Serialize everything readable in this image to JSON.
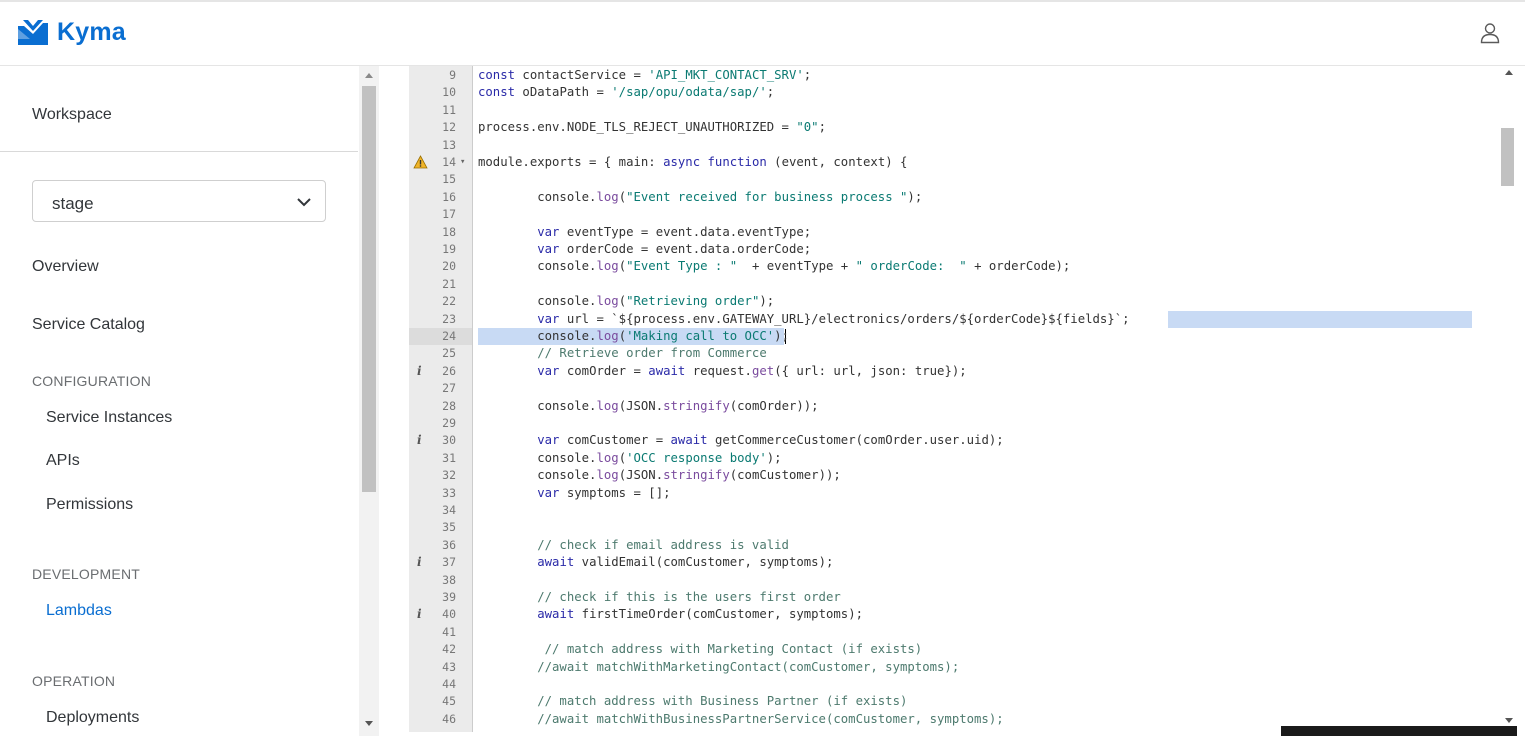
{
  "header": {
    "app_name": "Kyma",
    "logo_icon": "kyma-logo-icon",
    "user_icon": "user-icon",
    "accent": "#0a6ed1"
  },
  "sidebar": {
    "workspace": "Workspace",
    "namespace_select": {
      "value": "stage",
      "icon": "chevron-down-icon"
    },
    "overview": "Overview",
    "service_catalog": "Service Catalog",
    "sections": {
      "configuration": "CONFIGURATION",
      "development": "DEVELOPMENT",
      "operation": "OPERATION"
    },
    "configuration_items": [
      "Service Instances",
      "APIs",
      "Permissions"
    ],
    "development_items": [
      "Lambdas"
    ],
    "operation_items": [
      "Deployments"
    ],
    "active_item": "Lambdas"
  },
  "editor": {
    "lines": [
      {
        "n": "9",
        "marker": "",
        "fold": false,
        "text": "const contactService = 'API_MKT_CONTACT_SRV';"
      },
      {
        "n": "10",
        "marker": "",
        "fold": false,
        "text": "const oDataPath = '/sap/opu/odata/sap/';"
      },
      {
        "n": "11",
        "marker": "",
        "fold": false,
        "text": ""
      },
      {
        "n": "12",
        "marker": "",
        "fold": false,
        "text": "process.env.NODE_TLS_REJECT_UNAUTHORIZED = \"0\";"
      },
      {
        "n": "13",
        "marker": "",
        "fold": false,
        "text": ""
      },
      {
        "n": "14",
        "marker": "warning",
        "fold": true,
        "text": "module.exports = { main: async function (event, context) {"
      },
      {
        "n": "15",
        "marker": "",
        "fold": false,
        "text": ""
      },
      {
        "n": "16",
        "marker": "",
        "fold": false,
        "text": "        console.log(\"Event received for business process \");"
      },
      {
        "n": "17",
        "marker": "",
        "fold": false,
        "text": ""
      },
      {
        "n": "18",
        "marker": "",
        "fold": false,
        "text": "        var eventType = event.data.eventType;"
      },
      {
        "n": "19",
        "marker": "",
        "fold": false,
        "text": "        var orderCode = event.data.orderCode;"
      },
      {
        "n": "20",
        "marker": "",
        "fold": false,
        "text": "        console.log(\"Event Type : \"  + eventType + \" orderCode:  \" + orderCode);"
      },
      {
        "n": "21",
        "marker": "",
        "fold": false,
        "text": ""
      },
      {
        "n": "22",
        "marker": "",
        "fold": false,
        "text": "        console.log(\"Retrieving order\");"
      },
      {
        "n": "23",
        "marker": "",
        "fold": false,
        "text": "        var url = `${process.env.GATEWAY_URL}/electronics/orders/${orderCode}${fields}`;"
      },
      {
        "n": "24",
        "marker": "",
        "fold": false,
        "text": "        console.log('Making call to OCC');"
      },
      {
        "n": "25",
        "marker": "",
        "fold": false,
        "text": "        // Retrieve order from Commerce"
      },
      {
        "n": "26",
        "marker": "info",
        "fold": false,
        "text": "        var comOrder = await request.get({ url: url, json: true});"
      },
      {
        "n": "27",
        "marker": "",
        "fold": false,
        "text": ""
      },
      {
        "n": "28",
        "marker": "",
        "fold": false,
        "text": "        console.log(JSON.stringify(comOrder));"
      },
      {
        "n": "29",
        "marker": "",
        "fold": false,
        "text": ""
      },
      {
        "n": "30",
        "marker": "info",
        "fold": false,
        "text": "        var comCustomer = await getCommerceCustomer(comOrder.user.uid);"
      },
      {
        "n": "31",
        "marker": "",
        "fold": false,
        "text": "        console.log('OCC response body');"
      },
      {
        "n": "32",
        "marker": "",
        "fold": false,
        "text": "        console.log(JSON.stringify(comCustomer));"
      },
      {
        "n": "33",
        "marker": "",
        "fold": false,
        "text": "        var symptoms = [];"
      },
      {
        "n": "34",
        "marker": "",
        "fold": false,
        "text": ""
      },
      {
        "n": "35",
        "marker": "",
        "fold": false,
        "text": ""
      },
      {
        "n": "36",
        "marker": "",
        "fold": false,
        "text": "        // check if email address is valid"
      },
      {
        "n": "37",
        "marker": "info",
        "fold": false,
        "text": "        await validEmail(comCustomer, symptoms);"
      },
      {
        "n": "38",
        "marker": "",
        "fold": false,
        "text": ""
      },
      {
        "n": "39",
        "marker": "",
        "fold": false,
        "text": "        // check if this is the users first order"
      },
      {
        "n": "40",
        "marker": "info",
        "fold": false,
        "text": "        await firstTimeOrder(comCustomer, symptoms);"
      },
      {
        "n": "41",
        "marker": "",
        "fold": false,
        "text": ""
      },
      {
        "n": "42",
        "marker": "",
        "fold": false,
        "text": "         // match address with Marketing Contact (if exists)"
      },
      {
        "n": "43",
        "marker": "",
        "fold": false,
        "text": "        //await matchWithMarketingContact(comCustomer, symptoms);"
      },
      {
        "n": "44",
        "marker": "",
        "fold": false,
        "text": ""
      },
      {
        "n": "45",
        "marker": "",
        "fold": false,
        "text": "        // match address with Business Partner (if exists)"
      },
      {
        "n": "46",
        "marker": "",
        "fold": false,
        "text": "        //await matchWithBusinessPartnerService(comCustomer, symptoms);"
      }
    ],
    "selected_lines": [
      "23",
      "24"
    ]
  }
}
